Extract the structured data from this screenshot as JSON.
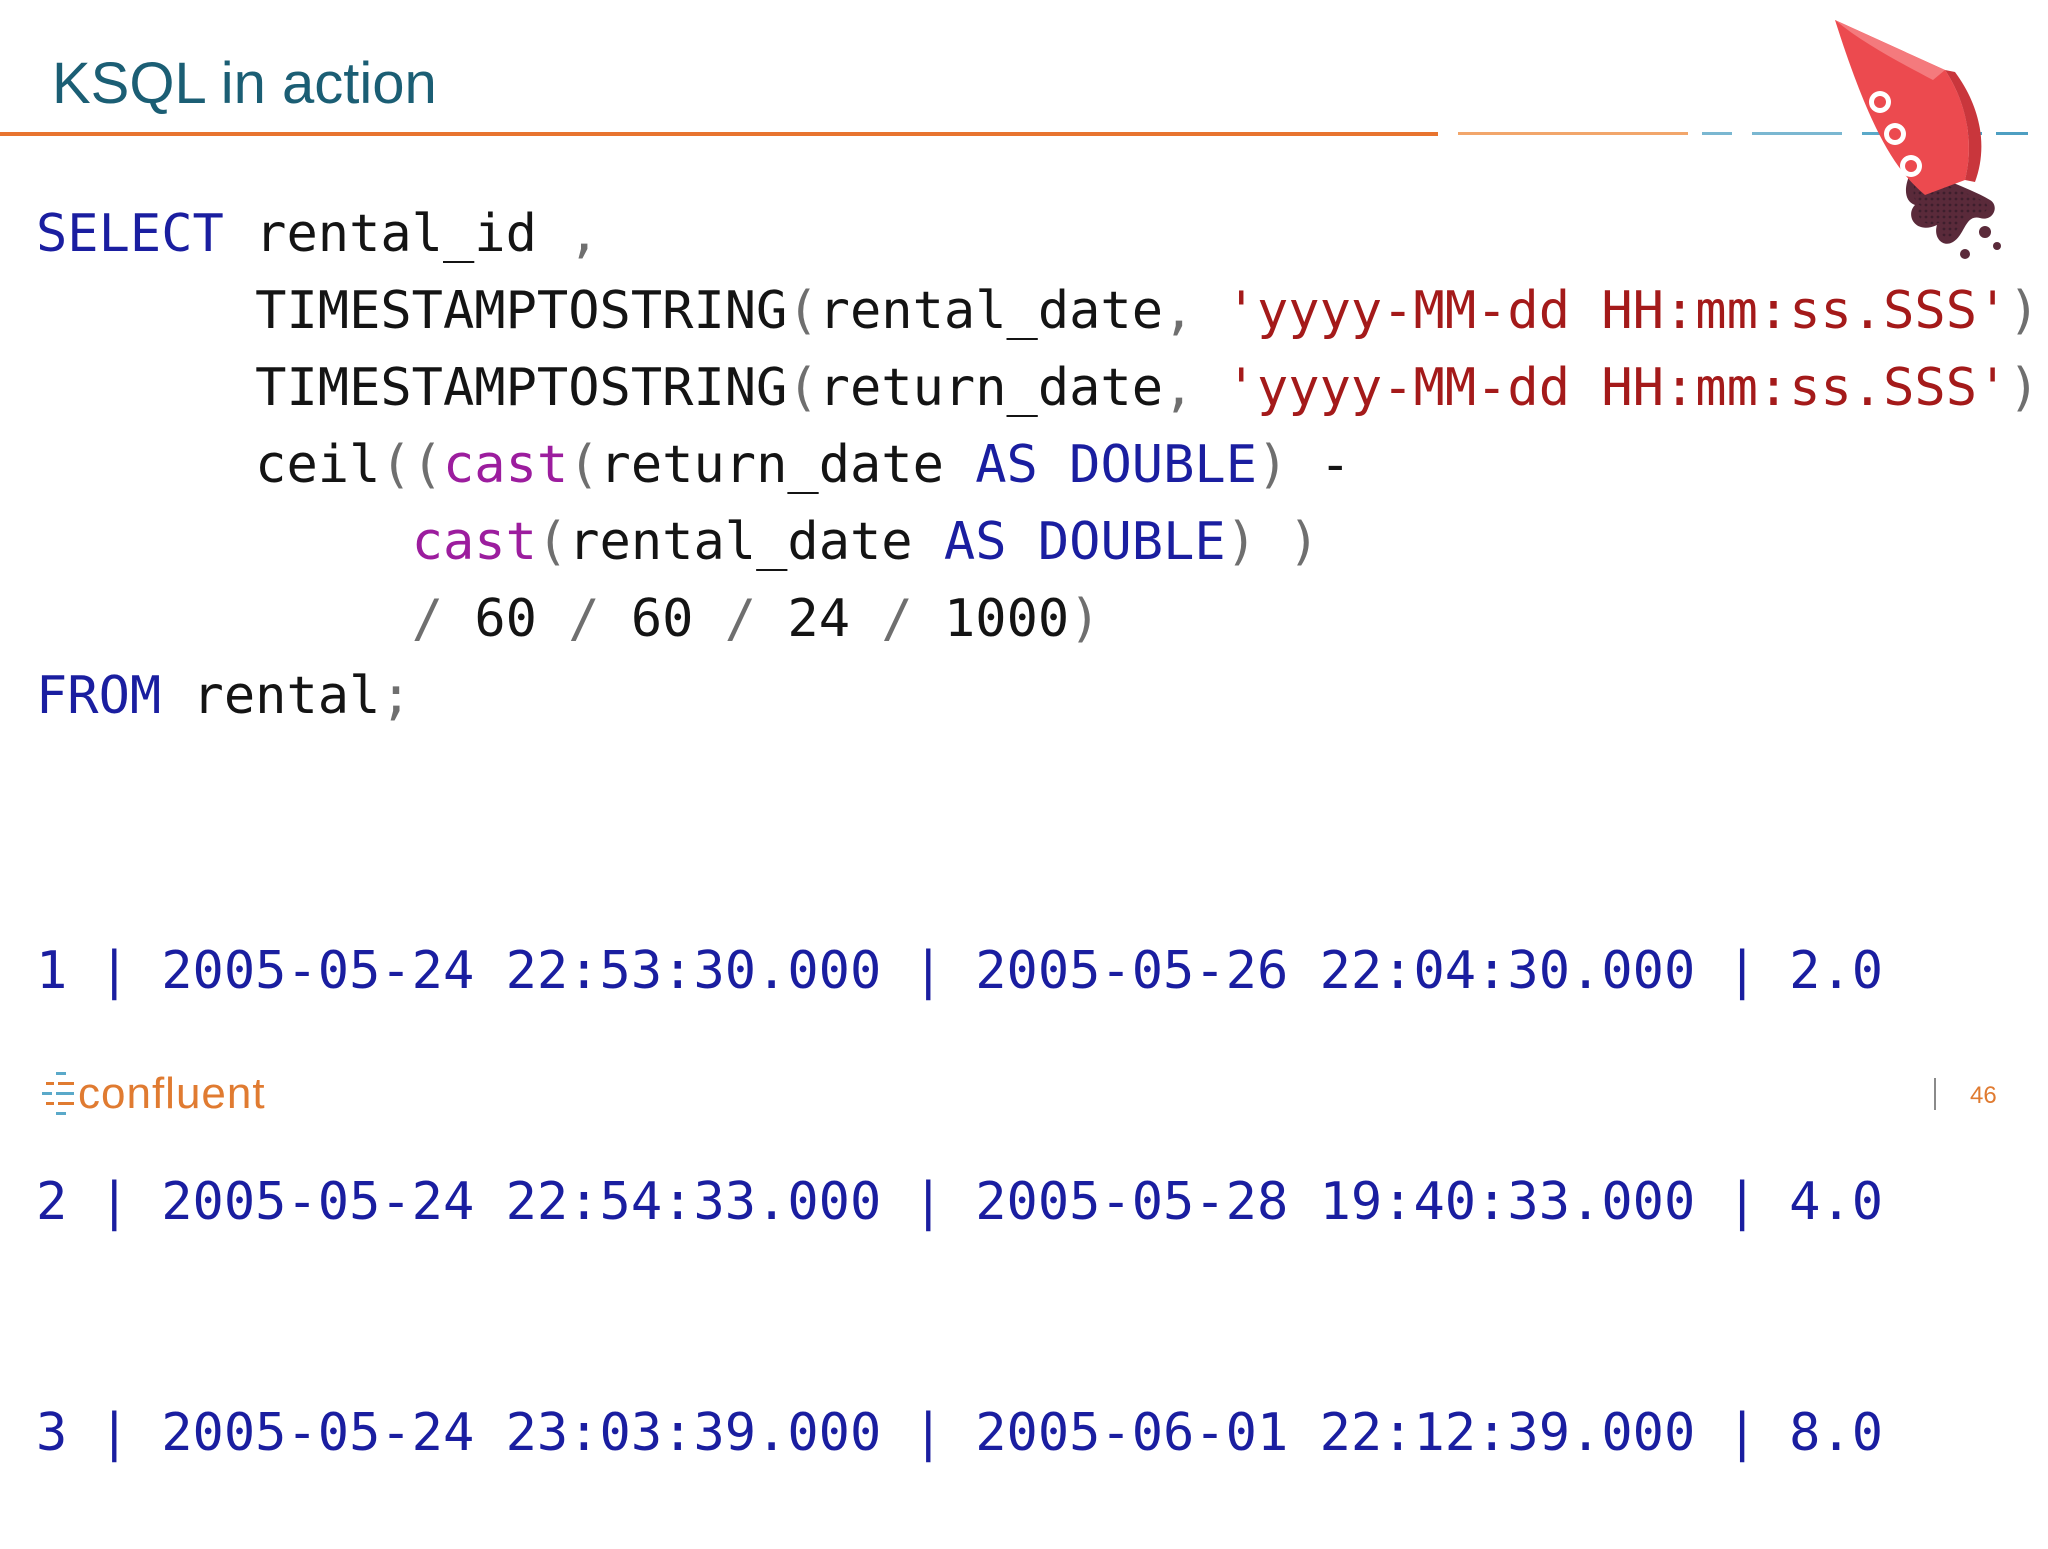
{
  "slide": {
    "title": "KSQL in action",
    "page_number": "46"
  },
  "code": {
    "lines": [
      [
        {
          "t": "SELECT",
          "c": "kw"
        },
        {
          "t": " rental_id ",
          "c": "id"
        },
        {
          "t": ",",
          "c": "pn"
        }
      ],
      [
        {
          "t": "       TIMESTAMPTOSTRING",
          "c": "id"
        },
        {
          "t": "(",
          "c": "pn"
        },
        {
          "t": "rental_date",
          "c": "id"
        },
        {
          "t": ", ",
          "c": "pn"
        },
        {
          "t": "'yyyy-MM-dd HH:mm:ss.SSS'",
          "c": "str"
        },
        {
          "t": "),",
          "c": "pn"
        }
      ],
      [
        {
          "t": "       TIMESTAMPTOSTRING",
          "c": "id"
        },
        {
          "t": "(",
          "c": "pn"
        },
        {
          "t": "return_date",
          "c": "id"
        },
        {
          "t": ", ",
          "c": "pn"
        },
        {
          "t": "'yyyy-MM-dd HH:mm:ss.SSS'",
          "c": "str"
        },
        {
          "t": "),",
          "c": "pn"
        }
      ],
      [
        {
          "t": "       ceil",
          "c": "id"
        },
        {
          "t": "((",
          "c": "pn"
        },
        {
          "t": "cast",
          "c": "fn"
        },
        {
          "t": "(",
          "c": "pn"
        },
        {
          "t": "return_date ",
          "c": "id"
        },
        {
          "t": "AS DOUBLE",
          "c": "kw"
        },
        {
          "t": ") ",
          "c": "pn"
        },
        {
          "t": "-",
          "c": "id"
        }
      ],
      [
        {
          "t": "            ",
          "c": "id"
        },
        {
          "t": "cast",
          "c": "fn"
        },
        {
          "t": "(",
          "c": "pn"
        },
        {
          "t": "rental_date ",
          "c": "id"
        },
        {
          "t": "AS DOUBLE",
          "c": "kw"
        },
        {
          "t": ") )",
          "c": "pn"
        }
      ],
      [
        {
          "t": "            ",
          "c": "id"
        },
        {
          "t": "/ ",
          "c": "pn"
        },
        {
          "t": "60 ",
          "c": "id"
        },
        {
          "t": "/ ",
          "c": "pn"
        },
        {
          "t": "60 ",
          "c": "id"
        },
        {
          "t": "/ ",
          "c": "pn"
        },
        {
          "t": "24 ",
          "c": "id"
        },
        {
          "t": "/ ",
          "c": "pn"
        },
        {
          "t": "1000",
          "c": "id"
        },
        {
          "t": ")",
          "c": "pn"
        }
      ],
      [
        {
          "t": "FROM",
          "c": "kw"
        },
        {
          "t": " rental",
          "c": "id"
        },
        {
          "t": ";",
          "c": "pn"
        }
      ]
    ]
  },
  "results": {
    "rows": [
      "1 | 2005-05-24 22:53:30.000 | 2005-05-26 22:04:30.000 | 2.0",
      "2 | 2005-05-24 22:54:33.000 | 2005-05-28 19:40:33.000 | 4.0",
      "3 | 2005-05-24 23:03:39.000 | 2005-06-01 22:12:39.000 | 8.0"
    ]
  },
  "branding": {
    "logo_text": "confluent",
    "rocket_label": "KSQL",
    "colors": {
      "title": "#1b5e74",
      "accent_orange": "#e07b31",
      "accent_blue": "#5aa9c9",
      "rocket_red": "#ec4a4f",
      "rocket_dark": "#5a2a3a"
    }
  }
}
